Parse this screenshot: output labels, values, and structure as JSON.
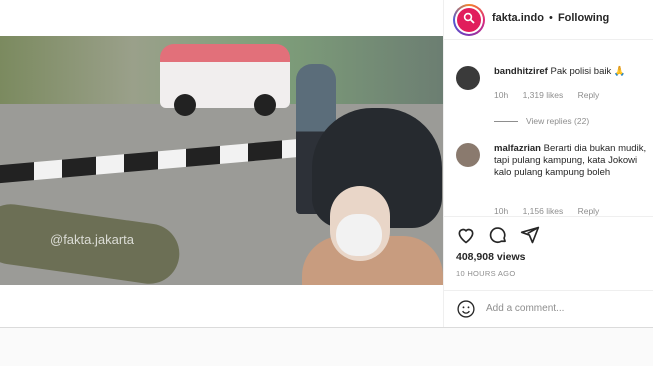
{
  "post": {
    "username": "fakta.indo",
    "separator": "•",
    "follow_status": "Following",
    "watermark": "@fakta.jakarta"
  },
  "comments": [
    {
      "username": "bandhitziref",
      "text": "Pak polisi baik 🙏",
      "time": "10h",
      "likes": "1,319 likes",
      "reply": "Reply",
      "view_replies": "View replies (22)"
    },
    {
      "username": "malfazrian",
      "text": "Berarti dia bukan mudik, tapi pulang kampung, kata Jokowi kalo pulang kampung boleh",
      "time": "10h",
      "likes": "1,156 likes",
      "reply": "Reply"
    }
  ],
  "stats": {
    "views": "408,908 views",
    "posted": "10 HOURS AGO"
  },
  "comment_box": {
    "placeholder": "Add a comment..."
  },
  "icons": [
    "search-icon",
    "mute-icon",
    "heart-icon",
    "comment-icon",
    "share-icon",
    "emoji-icon"
  ],
  "colors": {
    "text": "#262626",
    "muted": "#8e8e8e",
    "border": "#efefef",
    "avatar_brand": "#e11d5c"
  }
}
